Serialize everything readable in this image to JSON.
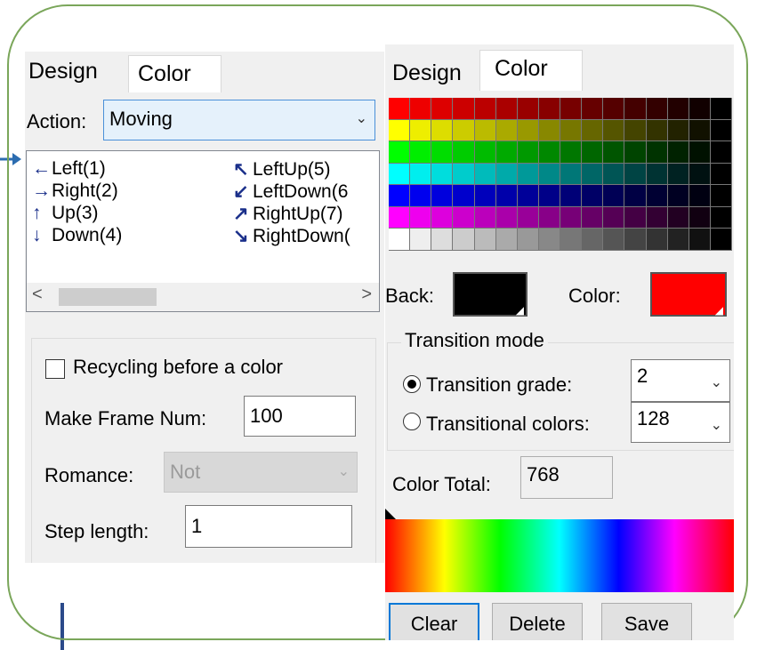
{
  "left_panel": {
    "tabs": [
      "Design",
      "Color"
    ],
    "action_label": "Action:",
    "action_value": "Moving",
    "directions": [
      {
        "arrow": "←",
        "label": "Left(1)"
      },
      {
        "arrow": "→",
        "label": "Right(2)"
      },
      {
        "arrow": "↑",
        "label": "Up(3)"
      },
      {
        "arrow": "↓",
        "label": "Down(4)"
      },
      {
        "arrow": "↖",
        "label": "LeftUp(5)"
      },
      {
        "arrow": "↙",
        "label": "LeftDown(6"
      },
      {
        "arrow": "↗",
        "label": "RightUp(7)"
      },
      {
        "arrow": "↘",
        "label": "RightDown("
      }
    ],
    "scroll_left": "<",
    "scroll_right": ">",
    "recycling_label": "Recycling before a color",
    "recycling_checked": false,
    "frame_num_label": "Make Frame Num:",
    "frame_num_value": "100",
    "romance_label": "Romance:",
    "romance_value": "Not",
    "step_label": "Step length:",
    "step_value": "1"
  },
  "right_panel": {
    "tabs": [
      "Design",
      "Color"
    ],
    "palette_rows": [
      [
        "#ff0000",
        "#ee0000",
        "#dd0000",
        "#cc0000",
        "#bb0000",
        "#aa0000",
        "#990000",
        "#880000",
        "#770000",
        "#660000",
        "#550000",
        "#440000",
        "#330000",
        "#220000",
        "#110000",
        "#000000"
      ],
      [
        "#ffff00",
        "#eeee00",
        "#dddd00",
        "#cccc00",
        "#bbbb00",
        "#aaaa00",
        "#999900",
        "#888800",
        "#777700",
        "#666600",
        "#555500",
        "#444400",
        "#333300",
        "#222200",
        "#111100",
        "#000000"
      ],
      [
        "#00ff00",
        "#00ee00",
        "#00dd00",
        "#00cc00",
        "#00bb00",
        "#00aa00",
        "#009900",
        "#008800",
        "#007700",
        "#006600",
        "#005500",
        "#004400",
        "#003300",
        "#002200",
        "#001100",
        "#000000"
      ],
      [
        "#00ffff",
        "#00eeee",
        "#00dddd",
        "#00cccc",
        "#00bbbb",
        "#00aaaa",
        "#009999",
        "#008888",
        "#007777",
        "#006666",
        "#005555",
        "#004444",
        "#003333",
        "#002222",
        "#001111",
        "#000000"
      ],
      [
        "#0000ff",
        "#0000ee",
        "#0000dd",
        "#0000cc",
        "#0000bb",
        "#0000aa",
        "#000099",
        "#000088",
        "#000077",
        "#000066",
        "#000055",
        "#000044",
        "#000033",
        "#000022",
        "#000011",
        "#000000"
      ],
      [
        "#ff00ff",
        "#ee00ee",
        "#dd00dd",
        "#cc00cc",
        "#bb00bb",
        "#aa00aa",
        "#990099",
        "#880088",
        "#770077",
        "#660066",
        "#550055",
        "#440044",
        "#330033",
        "#220022",
        "#110011",
        "#000000"
      ],
      [
        "#ffffff",
        "#eeeeee",
        "#dddddd",
        "#cccccc",
        "#bbbbbb",
        "#aaaaaa",
        "#999999",
        "#888888",
        "#777777",
        "#666666",
        "#555555",
        "#444444",
        "#333333",
        "#222222",
        "#111111",
        "#000000"
      ]
    ],
    "back_label": "Back:",
    "back_color": "#000000",
    "color_label": "Color:",
    "color_value": "#ff0000",
    "transition_title": "Transition mode",
    "grade_label": "Transition grade:",
    "grade_value": "2",
    "grade_selected": true,
    "colors_label": "Transitional colors:",
    "colors_value": "128",
    "total_label": "Color Total:",
    "total_value": "768",
    "buttons": {
      "clear": "Clear",
      "delete": "Delete",
      "save": "Save"
    }
  },
  "colors": {
    "frame_border": "#7aa65a",
    "annotation_blue": "#2b4a8a",
    "arrow_blue": "#1a2f8a",
    "focus_blue": "#0078d7"
  }
}
